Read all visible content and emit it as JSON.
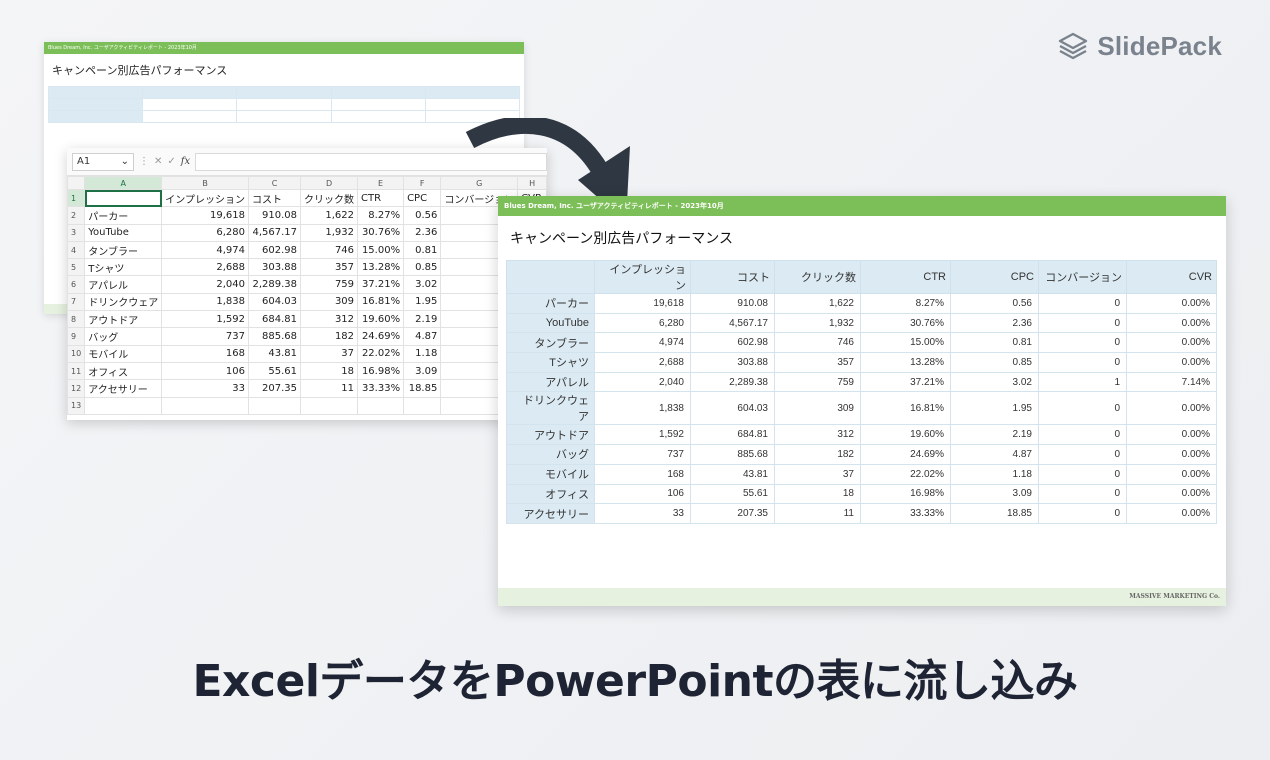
{
  "brand": {
    "name": "SlidePack",
    "icon": "stacked-layers-icon"
  },
  "back_slide": {
    "header": "Blues Dream, Inc. ユーザアクティビティレポート - 2023年10月",
    "title": "キャンペーン別広告パフォーマンス"
  },
  "excel": {
    "name_box": "A1",
    "columns": [
      "A",
      "B",
      "C",
      "D",
      "E",
      "F",
      "G",
      "H"
    ],
    "row_numbers": [
      "1",
      "2",
      "3",
      "4",
      "5",
      "6",
      "7",
      "8",
      "9",
      "10",
      "11",
      "12",
      "13"
    ],
    "header_row": [
      "",
      "インプレッション",
      "コスト",
      "クリック数",
      "CTR",
      "CPC",
      "コンバージョン",
      "CVR"
    ],
    "rows": [
      [
        "パーカー",
        "19,618",
        "910.08",
        "1,622",
        "8.27%",
        "0.56",
        "",
        ""
      ],
      [
        "YouTube",
        "6,280",
        "4,567.17",
        "1,932",
        "30.76%",
        "2.36",
        "",
        ""
      ],
      [
        "タンブラー",
        "4,974",
        "602.98",
        "746",
        "15.00%",
        "0.81",
        "",
        ""
      ],
      [
        "Tシャツ",
        "2,688",
        "303.88",
        "357",
        "13.28%",
        "0.85",
        "",
        ""
      ],
      [
        "アパレル",
        "2,040",
        "2,289.38",
        "759",
        "37.21%",
        "3.02",
        "",
        ""
      ],
      [
        "ドリンクウェア",
        "1,838",
        "604.03",
        "309",
        "16.81%",
        "1.95",
        "",
        ""
      ],
      [
        "アウトドア",
        "1,592",
        "684.81",
        "312",
        "19.60%",
        "2.19",
        "",
        ""
      ],
      [
        "バッグ",
        "737",
        "885.68",
        "182",
        "24.69%",
        "4.87",
        "",
        ""
      ],
      [
        "モバイル",
        "168",
        "43.81",
        "37",
        "22.02%",
        "1.18",
        "",
        ""
      ],
      [
        "オフィス",
        "106",
        "55.61",
        "18",
        "16.98%",
        "3.09",
        "",
        ""
      ],
      [
        "アクセサリー",
        "33",
        "207.35",
        "11",
        "33.33%",
        "18.85",
        "",
        ""
      ]
    ]
  },
  "front_slide": {
    "header": "Blues Dream, Inc. ユーザアクティビティレポート - 2023年10月",
    "title": "キャンペーン別広告パフォーマンス",
    "columns": [
      "",
      "インプレッション",
      "コスト",
      "クリック数",
      "CTR",
      "CPC",
      "コンバージョン",
      "CVR"
    ],
    "rows": [
      [
        "パーカー",
        "19,618",
        "910.08",
        "1,622",
        "8.27%",
        "0.56",
        "0",
        "0.00%"
      ],
      [
        "YouTube",
        "6,280",
        "4,567.17",
        "1,932",
        "30.76%",
        "2.36",
        "0",
        "0.00%"
      ],
      [
        "タンブラー",
        "4,974",
        "602.98",
        "746",
        "15.00%",
        "0.81",
        "0",
        "0.00%"
      ],
      [
        "Tシャツ",
        "2,688",
        "303.88",
        "357",
        "13.28%",
        "0.85",
        "0",
        "0.00%"
      ],
      [
        "アパレル",
        "2,040",
        "2,289.38",
        "759",
        "37.21%",
        "3.02",
        "1",
        "7.14%"
      ],
      [
        "ドリンクウェア",
        "1,838",
        "604.03",
        "309",
        "16.81%",
        "1.95",
        "0",
        "0.00%"
      ],
      [
        "アウトドア",
        "1,592",
        "684.81",
        "312",
        "19.60%",
        "2.19",
        "0",
        "0.00%"
      ],
      [
        "バッグ",
        "737",
        "885.68",
        "182",
        "24.69%",
        "4.87",
        "0",
        "0.00%"
      ],
      [
        "モバイル",
        "168",
        "43.81",
        "37",
        "22.02%",
        "1.18",
        "0",
        "0.00%"
      ],
      [
        "オフィス",
        "106",
        "55.61",
        "18",
        "16.98%",
        "3.09",
        "0",
        "0.00%"
      ],
      [
        "アクセサリー",
        "33",
        "207.35",
        "11",
        "33.33%",
        "18.85",
        "0",
        "0.00%"
      ]
    ],
    "footer": "MASSIVE MARKETING Co."
  },
  "caption": "ExcelデータをPowerPointの表に流し込み",
  "colors": {
    "accent_green": "#7cbe57",
    "header_blue": "#dcebf3",
    "caption": "#1e2433",
    "arrow": "#2f3742"
  }
}
